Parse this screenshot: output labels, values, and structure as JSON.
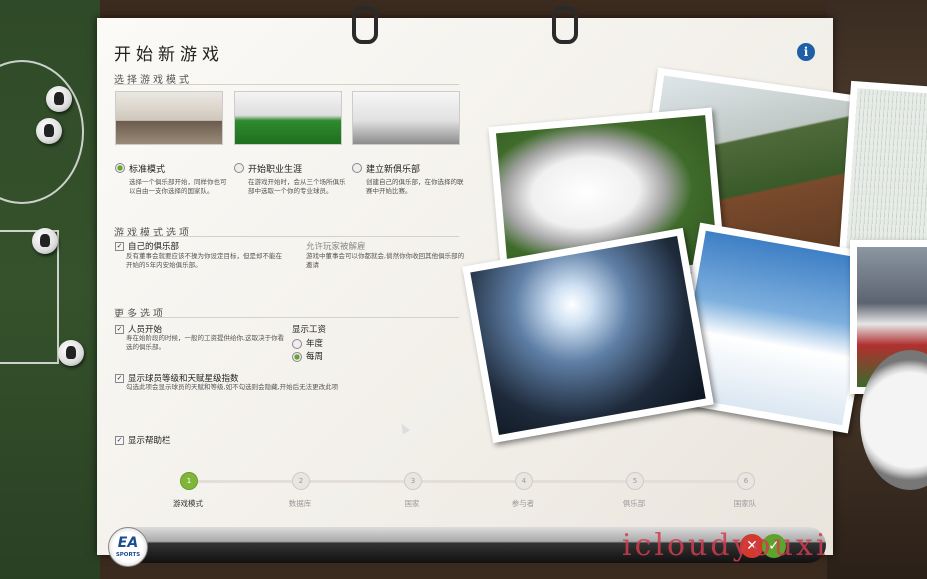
{
  "title": "开始新游戏",
  "sections": {
    "mode": "选择游戏模式",
    "mode_options": "游戏模式选项",
    "more": "更多选项"
  },
  "modes": [
    {
      "label": "标准模式",
      "desc": "选择一个俱乐部开始，同样你也可以自由一支你选择的国家队。",
      "selected": true
    },
    {
      "label": "开始职业生涯",
      "desc": "在游戏开始时，会从三个场所俱乐部中选取一个你的专业球员。",
      "selected": false
    },
    {
      "label": "建立新俱乐部",
      "desc": "创建自己的俱乐部，在你选择的联赛中开始比赛。",
      "selected": false
    }
  ],
  "mode_options": {
    "own_club_label": "自己的俱乐部",
    "own_club_desc": "反有董事会就要应该不操为你设定目标，但是却不能在开始的5年内安始俱乐部。",
    "allow_unemployed_label": "允许玩家被解雇",
    "allow_unemployed_desc": "游戏中董事会可以你都就会,倘然你你收回其他俱乐部的邀请"
  },
  "more": {
    "staff_label": "人员开始",
    "staff_desc": "寿在始阶段的时候，一般的工资提供给你,这取决于你看选的俱乐部。",
    "show_wage_label": "显示工资",
    "wage_options": [
      "年度",
      "每周"
    ],
    "wage_selected": 1,
    "show_rating_label": "显示球员等级和天赋星级指数",
    "show_rating_desc": "勾选此项会显示球员的天赋和等级,如不勾选则会隐藏,开始后无法更改此项",
    "help_label": "显示帮助栏"
  },
  "steps": [
    {
      "num": "1",
      "label": "游戏模式",
      "active": true
    },
    {
      "num": "2",
      "label": "数据库",
      "active": false
    },
    {
      "num": "3",
      "label": "国家",
      "active": false
    },
    {
      "num": "4",
      "label": "参与者",
      "active": false
    },
    {
      "num": "5",
      "label": "俱乐部",
      "active": false
    },
    {
      "num": "6",
      "label": "国家队",
      "active": false
    }
  ],
  "ea_logo": "EA",
  "ea_sub": "SPORTS",
  "watermark": "icloudyouxi",
  "icons": {
    "info": "i",
    "cancel": "✕",
    "confirm": "✓"
  },
  "colors": {
    "accent_green": "#7fb63a",
    "info_blue": "#1e5fa8",
    "cancel_red": "#d13a2e"
  }
}
